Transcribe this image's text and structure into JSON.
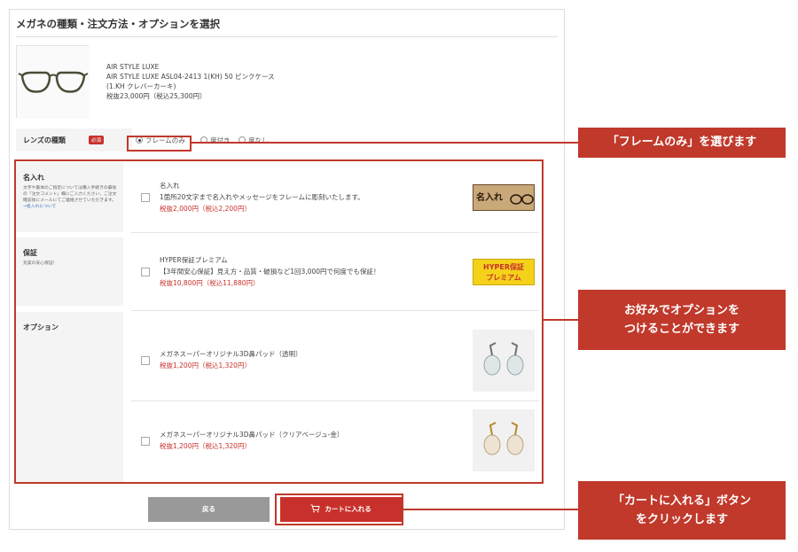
{
  "panel": {
    "title": "メガネの種類・注文方法・オプションを選択"
  },
  "product": {
    "line1": "AIR STYLE LUXE",
    "line2": "AIR STYLE LUXE ASL04-2413 1(KH) 50 ピンクケース",
    "line3": "(1.KH クレバーカーキ)",
    "line4": "税抜23,000円（税込25,300円）"
  },
  "lens": {
    "label": "レンズの種類",
    "required_badge": "必須",
    "options": [
      "フレームのみ",
      "度付き",
      "度なし"
    ],
    "selected_index": 0
  },
  "sections": {
    "engraving": {
      "title": "名入れ",
      "desc": "文字や書体のご指定については購入手続きの最後の「注文コメント」欄にご入力ください。ご注文確認後にメールにてご連絡させていただきます。",
      "link": "→名入れについて",
      "item_title": "名入れ",
      "item_desc": "1箇所20文字まで名入れやメッセージをフレームに彫刻いたします。",
      "item_price": "税抜2,000円（税込2,200円）",
      "banner": "名入れ"
    },
    "warranty": {
      "title": "保証",
      "desc": "充実の安心保証！",
      "item_title": "HYPER保証プレミアム",
      "item_desc": "【3年間安心保証】見え方・品質・破損など1回3,000円で何度でも保証！",
      "item_price": "税抜10,800円（税込11,880円）",
      "banner_line1": "HYPER保証",
      "banner_line2": "プレミアム"
    },
    "options": {
      "title": "オプション",
      "item1_title": "メガネスーパーオリジナル3D鼻パッド（透明）",
      "item1_price": "税抜1,200円（税込1,320円）",
      "item2_title": "メガネスーパーオリジナル3D鼻パッド（クリアベージュ-金）",
      "item2_price": "税抜1,200円（税込1,320円）"
    }
  },
  "buttons": {
    "back": "戻る",
    "cart": "カートに入れる"
  },
  "callouts": {
    "frame_only": "「フレームのみ」を選びます",
    "options_line1": "お好みでオプションを",
    "options_line2": "つけることができます",
    "cart_line1": "「カートに入れる」ボタン",
    "cart_line2": "をクリックします"
  },
  "colors": {
    "accent": "#c8312b",
    "callout": "#c0392b",
    "back_button": "#999999"
  }
}
